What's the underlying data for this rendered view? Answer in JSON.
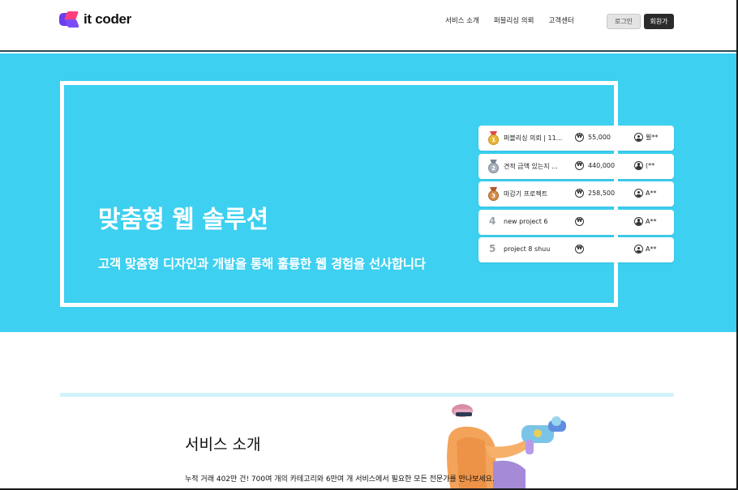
{
  "header": {
    "logo_text": "it coder",
    "nav": [
      "서비스 소개",
      "퍼블리싱 의뢰",
      "고객센터"
    ],
    "login_label": "로그인",
    "signup_label": "회원가입"
  },
  "hero": {
    "title": "맞춤형 웹 솔루션",
    "subtitle": "고객 맞춤형 디자인과 개발을 통해 훌륭한 웹 경험을 선사합니다"
  },
  "ranking": [
    {
      "rank": "1",
      "badge": "gold-medal-icon",
      "title": "퍼블리싱 의뢰 | 11...",
      "price": "55,000",
      "user": "윌**"
    },
    {
      "rank": "2",
      "badge": "silver-medal-icon",
      "title": "견적 금액 있는지 ...",
      "price": "440,000",
      "user": "(**"
    },
    {
      "rank": "3",
      "badge": "bronze-medal-icon",
      "title": "마감기 프로젝트",
      "price": "258,500",
      "user": "A**"
    },
    {
      "rank": "4",
      "badge": "",
      "title": "new project 6",
      "price": "",
      "user": "A**"
    },
    {
      "rank": "5",
      "badge": "",
      "title": "project 8 shuu",
      "price": "",
      "user": "A**"
    }
  ],
  "section": {
    "title": "서비스 소개",
    "description": "누적 거래 402만 건! 700여 개의 카테고리와 6만여 개 서비스에서  필요한 모든 전문가를 만나보세요."
  },
  "colors": {
    "hero_bg": "#3dd0f0",
    "divider": "#d3f3fb",
    "signup_bg": "#2b2b2b"
  }
}
